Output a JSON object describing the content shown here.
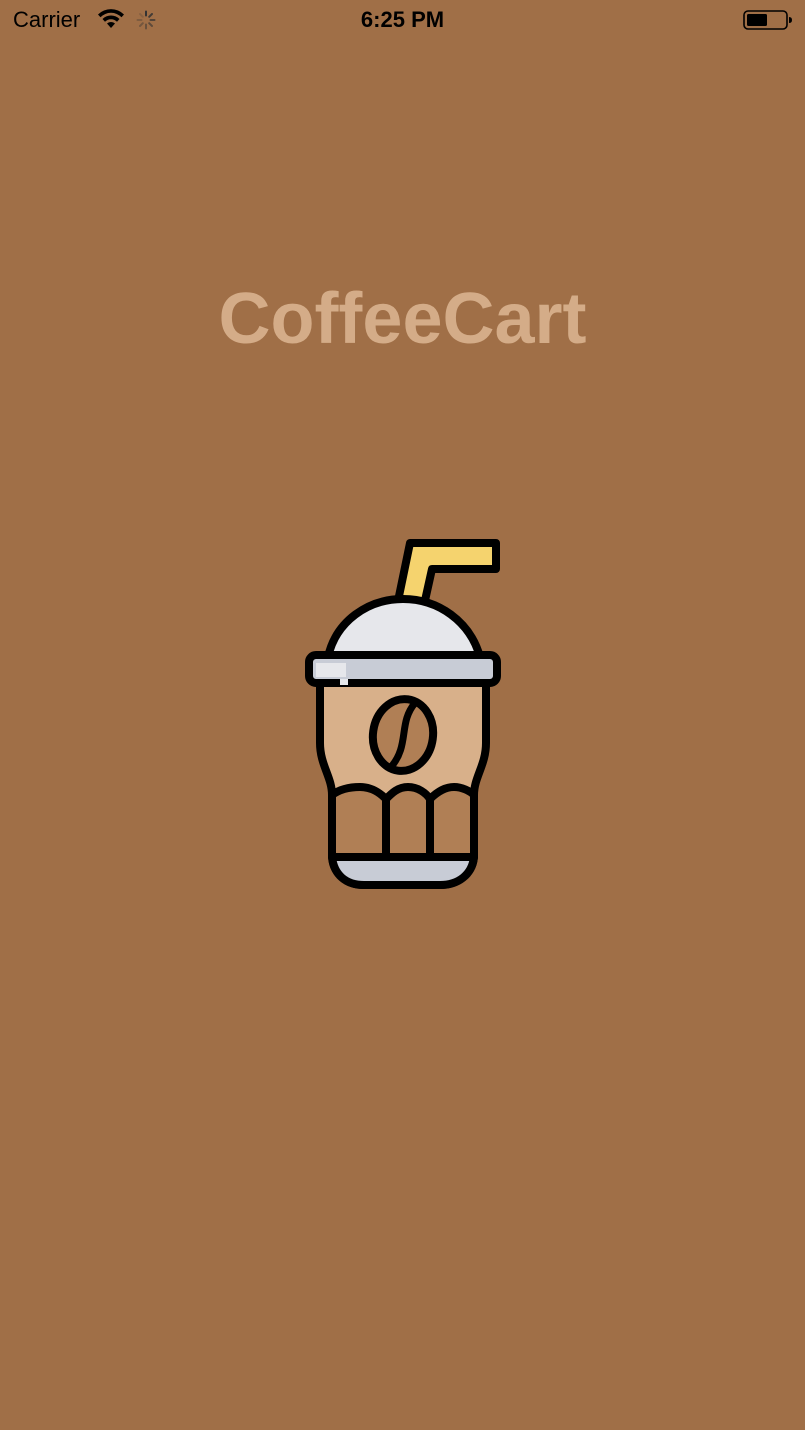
{
  "status_bar": {
    "carrier": "Carrier",
    "time": "6:25 PM",
    "wifi_icon": "wifi-icon",
    "activity_icon": "activity-spinner-icon",
    "battery_icon": "battery-icon"
  },
  "app": {
    "title": "CoffeeCart",
    "logo_icon": "iced-coffee-cup-icon"
  },
  "colors": {
    "background": "#a06f47",
    "title": "#d4ac88",
    "cup_fill": "#d8b08a",
    "lid": "#e6e7eb",
    "straw": "#f5d36e",
    "outline": "#000000"
  }
}
